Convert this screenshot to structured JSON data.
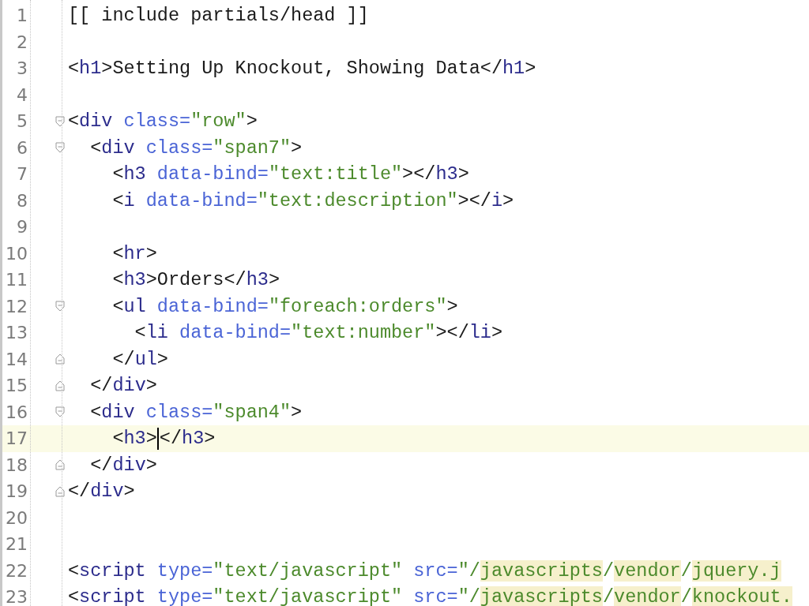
{
  "lines": [
    {
      "number": "1",
      "fold_start": false,
      "fold_end": false,
      "current": false,
      "tokens": [
        {
          "kind": "text",
          "text": "[[ include partials/head ]]"
        }
      ]
    },
    {
      "number": "2",
      "fold_start": false,
      "fold_end": false,
      "current": false
    },
    {
      "number": "3",
      "fold_start": false,
      "fold_end": false,
      "current": false,
      "tokens": [
        {
          "kind": "text",
          "text": "<"
        },
        {
          "kind": "tag",
          "text": "h1"
        },
        {
          "kind": "text",
          "text": ">Setting Up Knockout, Showing Data</"
        },
        {
          "kind": "tag",
          "text": "h1"
        },
        {
          "kind": "text",
          "text": ">"
        }
      ]
    },
    {
      "number": "4",
      "fold_start": false,
      "fold_end": false,
      "current": false
    },
    {
      "number": "5",
      "fold_start": true,
      "fold_end": false,
      "current": false,
      "tokens": [
        {
          "kind": "text",
          "text": "<"
        },
        {
          "kind": "tag",
          "text": "div"
        },
        {
          "kind": "attr",
          "text": " class="
        },
        {
          "kind": "string",
          "text": "\"row\""
        },
        {
          "kind": "text",
          "text": ">"
        }
      ]
    },
    {
      "number": "6",
      "fold_start": true,
      "fold_end": false,
      "current": false,
      "tokens": [
        {
          "kind": "text",
          "text": "  <"
        },
        {
          "kind": "tag",
          "text": "div"
        },
        {
          "kind": "attr",
          "text": " class="
        },
        {
          "kind": "string",
          "text": "\"span7\""
        },
        {
          "kind": "text",
          "text": ">"
        }
      ]
    },
    {
      "number": "7",
      "fold_start": false,
      "fold_end": false,
      "current": false,
      "tokens": [
        {
          "kind": "text",
          "text": "    <"
        },
        {
          "kind": "tag",
          "text": "h3"
        },
        {
          "kind": "attr",
          "text": " data-bind="
        },
        {
          "kind": "string",
          "text": "\"text:title\""
        },
        {
          "kind": "text",
          "text": "></"
        },
        {
          "kind": "tag",
          "text": "h3"
        },
        {
          "kind": "text",
          "text": ">"
        }
      ]
    },
    {
      "number": "8",
      "fold_start": false,
      "fold_end": false,
      "current": false,
      "tokens": [
        {
          "kind": "text",
          "text": "    <"
        },
        {
          "kind": "tag",
          "text": "i"
        },
        {
          "kind": "attr",
          "text": " data-bind="
        },
        {
          "kind": "string",
          "text": "\"text:description\""
        },
        {
          "kind": "text",
          "text": "></"
        },
        {
          "kind": "tag",
          "text": "i"
        },
        {
          "kind": "text",
          "text": ">"
        }
      ]
    },
    {
      "number": "9",
      "fold_start": false,
      "fold_end": false,
      "current": false
    },
    {
      "number": "10",
      "fold_start": false,
      "fold_end": false,
      "current": false,
      "tokens": [
        {
          "kind": "text",
          "text": "    <"
        },
        {
          "kind": "tag",
          "text": "hr"
        },
        {
          "kind": "text",
          "text": ">"
        }
      ]
    },
    {
      "number": "11",
      "fold_start": false,
      "fold_end": false,
      "current": false,
      "tokens": [
        {
          "kind": "text",
          "text": "    <"
        },
        {
          "kind": "tag",
          "text": "h3"
        },
        {
          "kind": "text",
          "text": ">Orders</"
        },
        {
          "kind": "tag",
          "text": "h3"
        },
        {
          "kind": "text",
          "text": ">"
        }
      ]
    },
    {
      "number": "12",
      "fold_start": true,
      "fold_end": false,
      "current": false,
      "tokens": [
        {
          "kind": "text",
          "text": "    <"
        },
        {
          "kind": "tag",
          "text": "ul"
        },
        {
          "kind": "attr",
          "text": " data-bind="
        },
        {
          "kind": "string",
          "text": "\"foreach:orders\""
        },
        {
          "kind": "text",
          "text": ">"
        }
      ]
    },
    {
      "number": "13",
      "fold_start": false,
      "fold_end": false,
      "current": false,
      "tokens": [
        {
          "kind": "text",
          "text": "      <"
        },
        {
          "kind": "tag",
          "text": "li"
        },
        {
          "kind": "attr",
          "text": " data-bind="
        },
        {
          "kind": "string",
          "text": "\"text:number\""
        },
        {
          "kind": "text",
          "text": "></"
        },
        {
          "kind": "tag",
          "text": "li"
        },
        {
          "kind": "text",
          "text": ">"
        }
      ]
    },
    {
      "number": "14",
      "fold_start": false,
      "fold_end": true,
      "current": false,
      "tokens": [
        {
          "kind": "text",
          "text": "    </"
        },
        {
          "kind": "tag",
          "text": "ul"
        },
        {
          "kind": "text",
          "text": ">"
        }
      ]
    },
    {
      "number": "15",
      "fold_start": false,
      "fold_end": true,
      "current": false,
      "tokens": [
        {
          "kind": "text",
          "text": "  </"
        },
        {
          "kind": "tag",
          "text": "div"
        },
        {
          "kind": "text",
          "text": ">"
        }
      ]
    },
    {
      "number": "16",
      "fold_start": true,
      "fold_end": false,
      "current": false,
      "tokens": [
        {
          "kind": "text",
          "text": "  <"
        },
        {
          "kind": "tag",
          "text": "div"
        },
        {
          "kind": "attr",
          "text": " class="
        },
        {
          "kind": "string",
          "text": "\"span4\""
        },
        {
          "kind": "text",
          "text": ">"
        }
      ]
    },
    {
      "number": "17",
      "fold_start": false,
      "fold_end": false,
      "current": true,
      "tokens": [
        {
          "kind": "text",
          "text": "    <"
        },
        {
          "kind": "tag",
          "text": "h3"
        },
        {
          "kind": "text",
          "text": ">",
          "caret": true
        },
        {
          "kind": "text",
          "text": "</"
        },
        {
          "kind": "tag",
          "text": "h3"
        },
        {
          "kind": "text",
          "text": ">"
        }
      ]
    },
    {
      "number": "18",
      "fold_start": false,
      "fold_end": true,
      "current": false,
      "tokens": [
        {
          "kind": "text",
          "text": "  </"
        },
        {
          "kind": "tag",
          "text": "div"
        },
        {
          "kind": "text",
          "text": ">"
        }
      ]
    },
    {
      "number": "19",
      "fold_start": false,
      "fold_end": true,
      "current": false,
      "tokens": [
        {
          "kind": "text",
          "text": "</"
        },
        {
          "kind": "tag",
          "text": "div"
        },
        {
          "kind": "text",
          "text": ">"
        }
      ]
    },
    {
      "number": "20",
      "fold_start": false,
      "fold_end": false,
      "current": false
    },
    {
      "number": "21",
      "fold_start": false,
      "fold_end": false,
      "current": false
    },
    {
      "number": "22",
      "fold_start": false,
      "fold_end": false,
      "current": false,
      "tokens": [
        {
          "kind": "text",
          "text": "<"
        },
        {
          "kind": "tag",
          "text": "script"
        },
        {
          "kind": "attr",
          "text": " type="
        },
        {
          "kind": "string",
          "text": "\"text/javascript\""
        },
        {
          "kind": "attr",
          "text": " src="
        },
        {
          "kind": "string",
          "text": "\"/"
        },
        {
          "kind": "path",
          "text": "javascripts"
        },
        {
          "kind": "string",
          "text": "/"
        },
        {
          "kind": "path",
          "text": "vendor"
        },
        {
          "kind": "string",
          "text": "/"
        },
        {
          "kind": "path",
          "text": "jquery.j"
        }
      ]
    },
    {
      "number": "23",
      "fold_start": false,
      "fold_end": false,
      "current": false,
      "tokens": [
        {
          "kind": "text",
          "text": "<"
        },
        {
          "kind": "tag",
          "text": "script"
        },
        {
          "kind": "attr",
          "text": " type="
        },
        {
          "kind": "string",
          "text": "\"text/javascript\""
        },
        {
          "kind": "attr",
          "text": " src="
        },
        {
          "kind": "string",
          "text": "\"/"
        },
        {
          "kind": "path",
          "text": "javascripts"
        },
        {
          "kind": "string",
          "text": "/"
        },
        {
          "kind": "path",
          "text": "vendor"
        },
        {
          "kind": "string",
          "text": "/"
        },
        {
          "kind": "path",
          "text": "knockout."
        }
      ]
    }
  ]
}
